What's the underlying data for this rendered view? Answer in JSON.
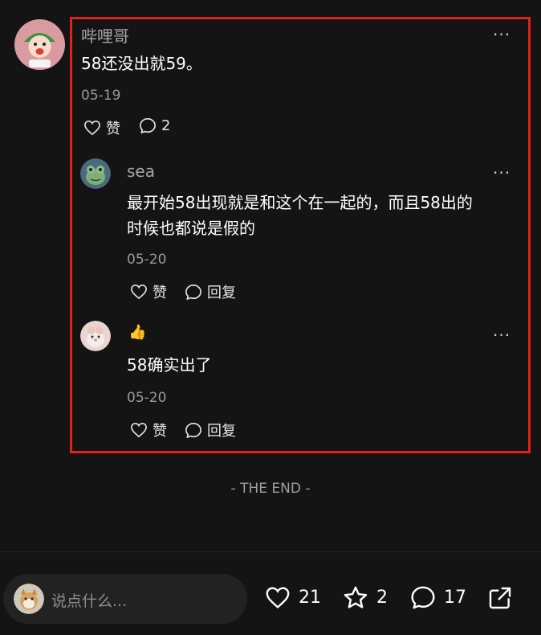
{
  "comment": {
    "author": "哔哩哥",
    "text": "58还没出就59。",
    "date": "05-19",
    "like_label": "赞",
    "reply_count": "2"
  },
  "replies": [
    {
      "author": "sea",
      "text_line1": "最开始58出现就是和这个在一起的，而且58出的",
      "text_line2": "时候也都说是假的",
      "date": "05-20",
      "like_label": "赞",
      "reply_label": "回复"
    },
    {
      "author": "👍",
      "text_line1": "58确实出了",
      "date": "05-20",
      "like_label": "赞",
      "reply_label": "回复"
    }
  ],
  "more_label": "···",
  "end_label": "- THE END -",
  "bottom_bar": {
    "input_placeholder": "说点什么...",
    "likes": "21",
    "stars": "2",
    "comments": "17"
  },
  "colors": {
    "background": "#141414",
    "highlight": "#e22218"
  }
}
